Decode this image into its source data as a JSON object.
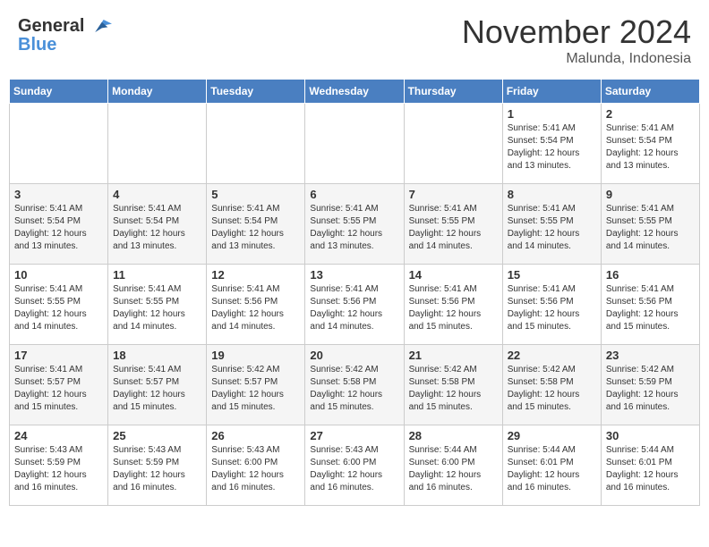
{
  "header": {
    "logo_general": "General",
    "logo_blue": "Blue",
    "month_title": "November 2024",
    "location": "Malunda, Indonesia"
  },
  "weekdays": [
    "Sunday",
    "Monday",
    "Tuesday",
    "Wednesday",
    "Thursday",
    "Friday",
    "Saturday"
  ],
  "weeks": [
    [
      {
        "day": "",
        "info": ""
      },
      {
        "day": "",
        "info": ""
      },
      {
        "day": "",
        "info": ""
      },
      {
        "day": "",
        "info": ""
      },
      {
        "day": "",
        "info": ""
      },
      {
        "day": "1",
        "info": "Sunrise: 5:41 AM\nSunset: 5:54 PM\nDaylight: 12 hours\nand 13 minutes."
      },
      {
        "day": "2",
        "info": "Sunrise: 5:41 AM\nSunset: 5:54 PM\nDaylight: 12 hours\nand 13 minutes."
      }
    ],
    [
      {
        "day": "3",
        "info": "Sunrise: 5:41 AM\nSunset: 5:54 PM\nDaylight: 12 hours\nand 13 minutes."
      },
      {
        "day": "4",
        "info": "Sunrise: 5:41 AM\nSunset: 5:54 PM\nDaylight: 12 hours\nand 13 minutes."
      },
      {
        "day": "5",
        "info": "Sunrise: 5:41 AM\nSunset: 5:54 PM\nDaylight: 12 hours\nand 13 minutes."
      },
      {
        "day": "6",
        "info": "Sunrise: 5:41 AM\nSunset: 5:55 PM\nDaylight: 12 hours\nand 13 minutes."
      },
      {
        "day": "7",
        "info": "Sunrise: 5:41 AM\nSunset: 5:55 PM\nDaylight: 12 hours\nand 14 minutes."
      },
      {
        "day": "8",
        "info": "Sunrise: 5:41 AM\nSunset: 5:55 PM\nDaylight: 12 hours\nand 14 minutes."
      },
      {
        "day": "9",
        "info": "Sunrise: 5:41 AM\nSunset: 5:55 PM\nDaylight: 12 hours\nand 14 minutes."
      }
    ],
    [
      {
        "day": "10",
        "info": "Sunrise: 5:41 AM\nSunset: 5:55 PM\nDaylight: 12 hours\nand 14 minutes."
      },
      {
        "day": "11",
        "info": "Sunrise: 5:41 AM\nSunset: 5:55 PM\nDaylight: 12 hours\nand 14 minutes."
      },
      {
        "day": "12",
        "info": "Sunrise: 5:41 AM\nSunset: 5:56 PM\nDaylight: 12 hours\nand 14 minutes."
      },
      {
        "day": "13",
        "info": "Sunrise: 5:41 AM\nSunset: 5:56 PM\nDaylight: 12 hours\nand 14 minutes."
      },
      {
        "day": "14",
        "info": "Sunrise: 5:41 AM\nSunset: 5:56 PM\nDaylight: 12 hours\nand 15 minutes."
      },
      {
        "day": "15",
        "info": "Sunrise: 5:41 AM\nSunset: 5:56 PM\nDaylight: 12 hours\nand 15 minutes."
      },
      {
        "day": "16",
        "info": "Sunrise: 5:41 AM\nSunset: 5:56 PM\nDaylight: 12 hours\nand 15 minutes."
      }
    ],
    [
      {
        "day": "17",
        "info": "Sunrise: 5:41 AM\nSunset: 5:57 PM\nDaylight: 12 hours\nand 15 minutes."
      },
      {
        "day": "18",
        "info": "Sunrise: 5:41 AM\nSunset: 5:57 PM\nDaylight: 12 hours\nand 15 minutes."
      },
      {
        "day": "19",
        "info": "Sunrise: 5:42 AM\nSunset: 5:57 PM\nDaylight: 12 hours\nand 15 minutes."
      },
      {
        "day": "20",
        "info": "Sunrise: 5:42 AM\nSunset: 5:58 PM\nDaylight: 12 hours\nand 15 minutes."
      },
      {
        "day": "21",
        "info": "Sunrise: 5:42 AM\nSunset: 5:58 PM\nDaylight: 12 hours\nand 15 minutes."
      },
      {
        "day": "22",
        "info": "Sunrise: 5:42 AM\nSunset: 5:58 PM\nDaylight: 12 hours\nand 15 minutes."
      },
      {
        "day": "23",
        "info": "Sunrise: 5:42 AM\nSunset: 5:59 PM\nDaylight: 12 hours\nand 16 minutes."
      }
    ],
    [
      {
        "day": "24",
        "info": "Sunrise: 5:43 AM\nSunset: 5:59 PM\nDaylight: 12 hours\nand 16 minutes."
      },
      {
        "day": "25",
        "info": "Sunrise: 5:43 AM\nSunset: 5:59 PM\nDaylight: 12 hours\nand 16 minutes."
      },
      {
        "day": "26",
        "info": "Sunrise: 5:43 AM\nSunset: 6:00 PM\nDaylight: 12 hours\nand 16 minutes."
      },
      {
        "day": "27",
        "info": "Sunrise: 5:43 AM\nSunset: 6:00 PM\nDaylight: 12 hours\nand 16 minutes."
      },
      {
        "day": "28",
        "info": "Sunrise: 5:44 AM\nSunset: 6:00 PM\nDaylight: 12 hours\nand 16 minutes."
      },
      {
        "day": "29",
        "info": "Sunrise: 5:44 AM\nSunset: 6:01 PM\nDaylight: 12 hours\nand 16 minutes."
      },
      {
        "day": "30",
        "info": "Sunrise: 5:44 AM\nSunset: 6:01 PM\nDaylight: 12 hours\nand 16 minutes."
      }
    ]
  ]
}
